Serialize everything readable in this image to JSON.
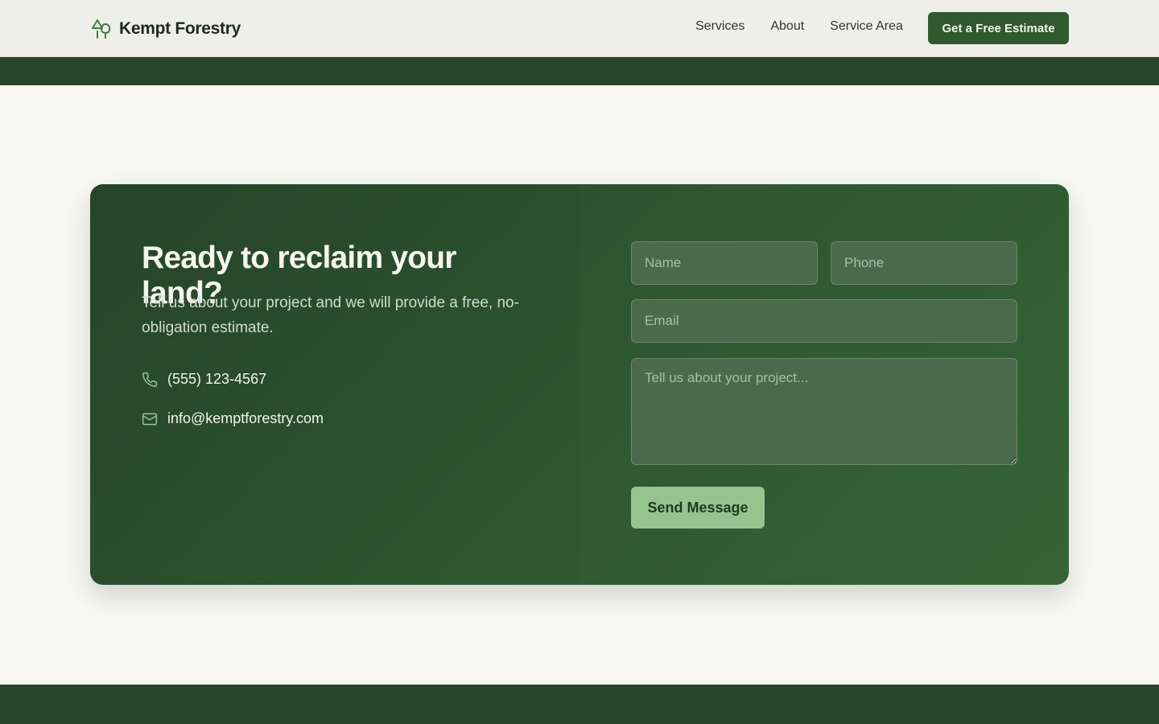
{
  "brand": {
    "name": "Kempt Forestry",
    "logo_icon": "trees-icon",
    "accent": "#2e5a2e"
  },
  "nav": {
    "links": [
      {
        "label": "Services"
      },
      {
        "label": "About"
      },
      {
        "label": "Service Area"
      }
    ],
    "cta_label": "Get a Free Estimate"
  },
  "contact": {
    "headline": "Ready to reclaim your land?",
    "subcopy": "Tell us about your project and we will provide a free, no-obligation estimate.",
    "phone": {
      "icon": "phone-icon",
      "text": "(555) 123-4567"
    },
    "email": {
      "icon": "mail-icon",
      "text": "info@kemptforestry.com"
    }
  },
  "form": {
    "name_placeholder": "Name",
    "phone_placeholder": "Phone",
    "email_placeholder": "Email",
    "message_placeholder": "Tell us about your project...",
    "submit_label": "Send Message"
  },
  "colors": {
    "band": "#27442a",
    "card_start": "#28472b",
    "card_end": "#356537",
    "button_light": "#95c58f",
    "page_bg": "#f8f8f2"
  }
}
